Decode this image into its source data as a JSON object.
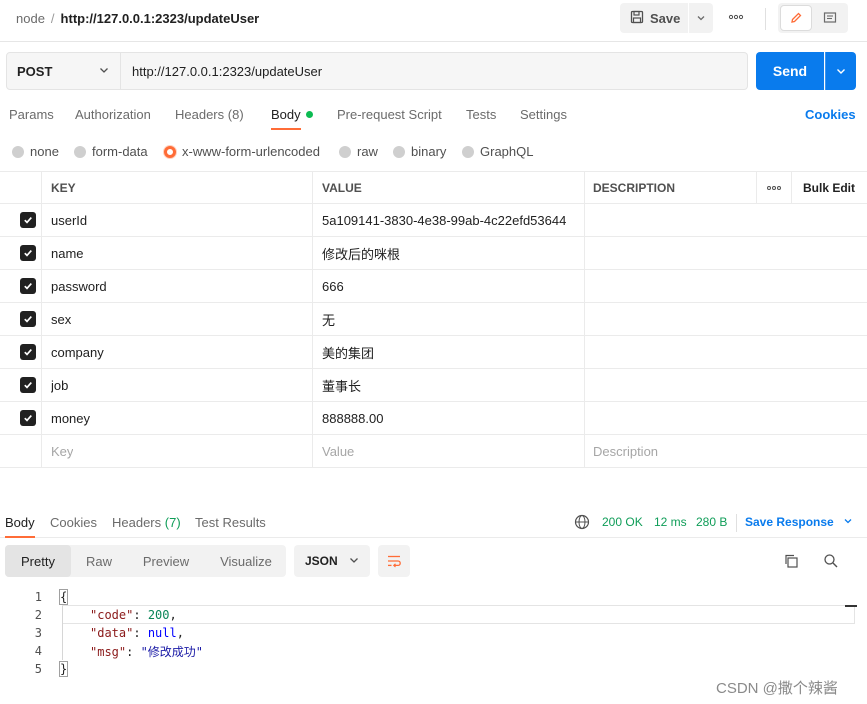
{
  "topbar": {
    "collection": "node",
    "separator": "/",
    "request_name": "http://127.0.0.1:2323/updateUser",
    "save_label": "Save",
    "more_icon": "more-dots-icon"
  },
  "request": {
    "method": "POST",
    "url": "http://127.0.0.1:2323/updateUser",
    "send_label": "Send"
  },
  "req_tabs": {
    "params": "Params",
    "authorization": "Authorization",
    "headers": "Headers",
    "headers_count": "(8)",
    "body": "Body",
    "prerequest": "Pre-request Script",
    "tests": "Tests",
    "settings": "Settings",
    "cookies": "Cookies"
  },
  "body_types": {
    "none": "none",
    "form_data": "form-data",
    "urlencoded": "x-www-form-urlencoded",
    "raw": "raw",
    "binary": "binary",
    "graphql": "GraphQL",
    "selected": "x-www-form-urlencoded"
  },
  "params_table": {
    "col_key": "KEY",
    "col_value": "VALUE",
    "col_description": "DESCRIPTION",
    "more": "ooo",
    "bulk_edit": "Bulk Edit",
    "rows": [
      {
        "key": "userId",
        "value": "5a109141-3830-4e38-99ab-4c22efd53644",
        "description": "",
        "checked": true
      },
      {
        "key": "name",
        "value": "修改后的咪根",
        "description": "",
        "checked": true
      },
      {
        "key": "password",
        "value": "666",
        "description": "",
        "checked": true
      },
      {
        "key": "sex",
        "value": "无",
        "description": "",
        "checked": true
      },
      {
        "key": "company",
        "value": "美的集团",
        "description": "",
        "checked": true
      },
      {
        "key": "job",
        "value": "董事长",
        "description": "",
        "checked": true
      },
      {
        "key": "money",
        "value": "888888.00",
        "description": "",
        "checked": true
      }
    ],
    "placeholder_key": "Key",
    "placeholder_value": "Value",
    "placeholder_description": "Description"
  },
  "response": {
    "tabs": {
      "body": "Body",
      "cookies": "Cookies",
      "headers": "Headers",
      "headers_count": "(7)",
      "test_results": "Test Results"
    },
    "status": "200 OK",
    "time": "12 ms",
    "size": "280 B",
    "save_response": "Save Response",
    "views": {
      "pretty": "Pretty",
      "raw": "Raw",
      "preview": "Preview",
      "visualize": "Visualize"
    },
    "format": "JSON",
    "code_lines": [
      {
        "num": "1",
        "text": "{"
      },
      {
        "num": "2",
        "key": "\"code\"",
        "value": "200",
        "value_type": "number",
        "trail": ","
      },
      {
        "num": "3",
        "key": "\"data\"",
        "value": "null",
        "value_type": "null",
        "trail": ","
      },
      {
        "num": "4",
        "key": "\"msg\"",
        "value": "\"修改成功\"",
        "value_type": "string",
        "trail": ""
      },
      {
        "num": "5",
        "text": "}"
      }
    ]
  },
  "watermark": "CSDN @撒个辣酱"
}
